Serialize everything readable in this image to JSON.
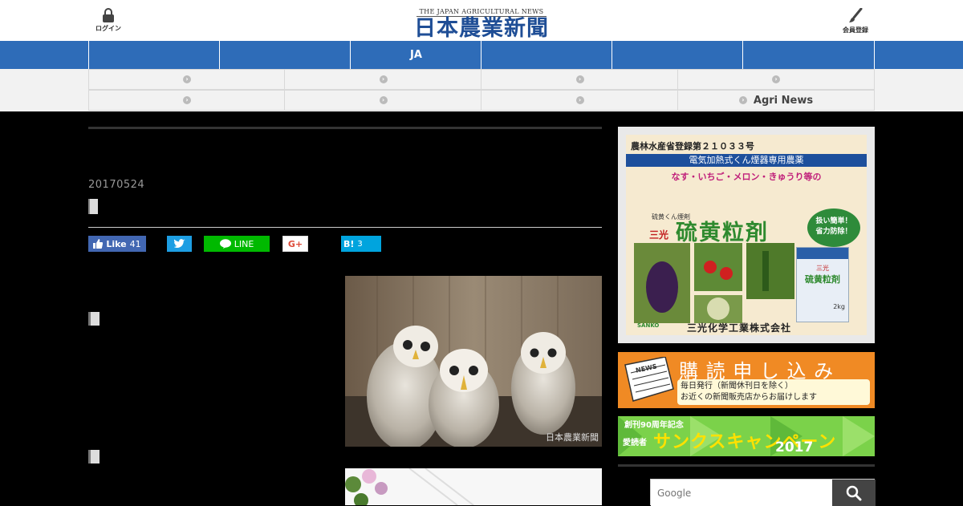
{
  "header": {
    "login_label": "ログイン",
    "register_label": "会員登録",
    "logo_en": "THE JAPAN AGRICULTURAL NEWS",
    "logo_ja": "日本農業新聞"
  },
  "nav_main": {
    "items": [
      "",
      "",
      "JA",
      "",
      "",
      ""
    ]
  },
  "nav_sub": {
    "row1": [
      "",
      "",
      "",
      ""
    ],
    "row2": [
      "",
      "",
      "",
      "Agri News"
    ]
  },
  "article": {
    "date": "20170524"
  },
  "share": {
    "facebook_label": "Like",
    "facebook_count": "41",
    "line_label": "LINE",
    "gplus_label": "G+",
    "hatena_label": "B!",
    "hatena_count": "3"
  },
  "photo": {
    "watermark": "日本農業新聞"
  },
  "ads": {
    "ad1": {
      "reg": "農林水産省登録第２１０３３号",
      "subtitle": "電気加熱式くん煙器専用農薬",
      "crops": "なす・いちご・メロン・きゅうり等の",
      "small": "硫黄くん煙剤",
      "brand": "三光",
      "product": "硫黄粒剤",
      "badge_line1": "扱い簡単！",
      "badge_line2": "省力防除！",
      "package_brand": "三光",
      "package_product": "硫黄粒剤",
      "package_weight": "2kg",
      "maker_mark": "SANKO",
      "company": "三光化学工業株式会社"
    },
    "ad2": {
      "title": "購 読 申 し 込 み",
      "line1": "毎日発行（新聞休刊日を除く）",
      "line2": "お近くの新聞販売店からお届けします",
      "paper_label": "NEWS"
    },
    "ad3": {
      "anniv": "創刊90周年記念",
      "readers": "愛読者",
      "campaign": "サンクスキャンペーン",
      "year": "2017"
    }
  },
  "search": {
    "placeholder": "Google"
  },
  "colors": {
    "nav_blue": "#2e6cb8",
    "logo_blue": "#1f4e96",
    "line_green": "#00b900",
    "facebook": "#3b5998",
    "twitter": "#1da1f2"
  }
}
